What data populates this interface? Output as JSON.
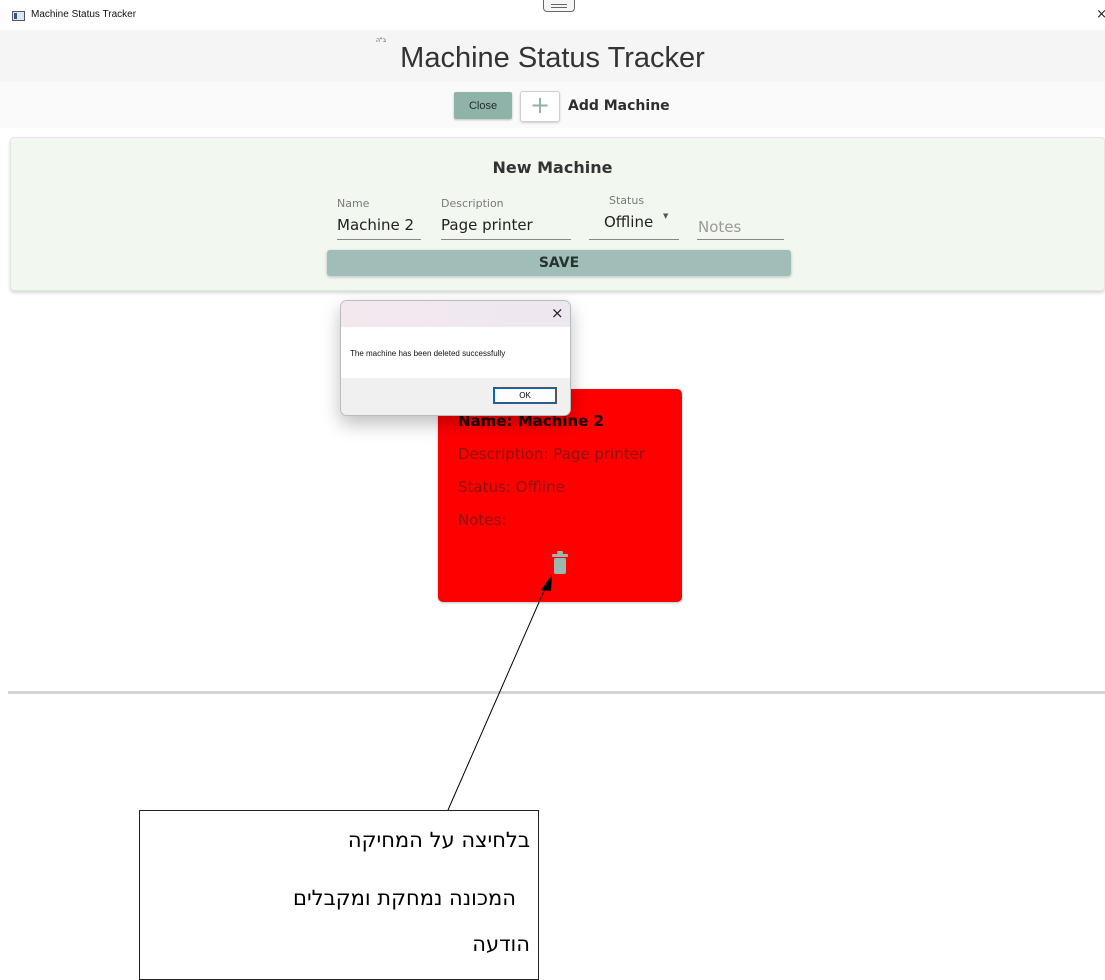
{
  "window": {
    "title": "Machine Status Tracker",
    "close_glyph": "×"
  },
  "header": {
    "hebrew_mark": "ב\"ה",
    "title": "Machine Status Tracker"
  },
  "toolbar": {
    "close_label": "Close",
    "add_icon": "plus-icon",
    "add_glyph": "+",
    "add_label": "Add Machine"
  },
  "new_machine": {
    "title": "New Machine",
    "fields": {
      "name": {
        "label": "Name",
        "value": "Machine 2"
      },
      "description": {
        "label": "Description",
        "value": "Page printer"
      },
      "status": {
        "label": "Status",
        "value": "Offline"
      },
      "notes": {
        "placeholder": "Notes"
      }
    },
    "save_label": "SAVE"
  },
  "machine_card": {
    "name": "Name: Machine 2",
    "description": "Description: Page printer",
    "status": "Status: Offline",
    "notes": "Notes:",
    "color": "#ff0000",
    "delete_icon": "trash-icon"
  },
  "dialog": {
    "close_glyph": "×",
    "message": "The machine has been deleted successfully",
    "ok_label": "OK"
  },
  "callout": {
    "line1": "בלחיצה על המחיקה",
    "line2": "המכונה נמחקת ומקבלים",
    "line3": "הודעה"
  },
  "colors": {
    "primary_button": "#8fb2a9",
    "save_button": "#a0beb7",
    "panel_background": "#f2f7f0",
    "offline_card": "#ff0000"
  }
}
